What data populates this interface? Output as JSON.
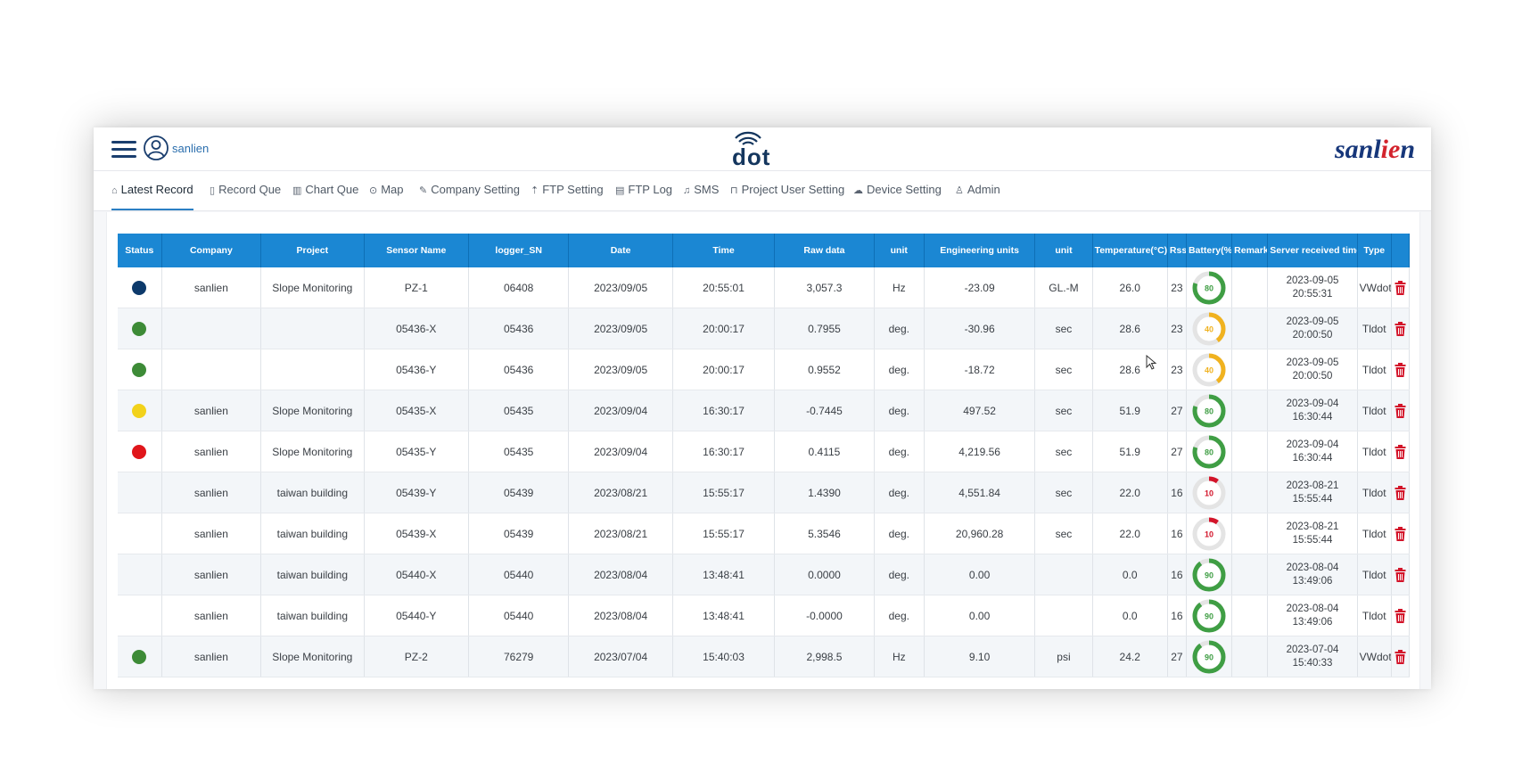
{
  "app": {
    "username": "sanlien",
    "center_logo": "dot",
    "brand_left": "sanl",
    "brand_accent": "ie",
    "brand_right": "n"
  },
  "nav": [
    {
      "label": "Latest Record",
      "icon": "home-icon"
    },
    {
      "label": "Record Que",
      "icon": "document-icon"
    },
    {
      "label": "Chart Que",
      "icon": "bar-chart-icon"
    },
    {
      "label": "Map",
      "icon": "map-pin-icon"
    },
    {
      "label": "Company Setting",
      "icon": "edit-icon"
    },
    {
      "label": "FTP Setting",
      "icon": "upload-icon"
    },
    {
      "label": "FTP Log",
      "icon": "file-icon"
    },
    {
      "label": "SMS",
      "icon": "bell-icon"
    },
    {
      "label": "Project User Setting",
      "icon": "lock-icon"
    },
    {
      "label": "Device Setting",
      "icon": "cloud-icon"
    },
    {
      "label": "Admin",
      "icon": "user-icon"
    }
  ],
  "table": {
    "headers": [
      "Status",
      "Company",
      "Project",
      "Sensor Name",
      "logger_SN",
      "Date",
      "Time",
      "Raw data",
      "unit",
      "Engineering units",
      "unit",
      "Temperature(°C)",
      "Rssi",
      "Battery(%)",
      "Remark",
      "Server received time",
      "Type",
      ""
    ],
    "rows": [
      {
        "status": "#0d3a6b",
        "company": "sanlien",
        "project": "Slope Monitoring",
        "sensor": "PZ-1",
        "logger": "06408",
        "date": "2023/09/05",
        "time": "20:55:01",
        "raw": "3,057.3",
        "unit1": "Hz",
        "eng": "-23.09",
        "unit2": "GL.-M",
        "temp": "26.0",
        "rssi": "23",
        "battery": "80",
        "remark": "",
        "srv_date": "2023-09-05",
        "srv_time": "20:55:31",
        "type": "VWdot"
      },
      {
        "status": "#3d8b37",
        "company": "",
        "project": "",
        "sensor": "05436-X",
        "logger": "05436",
        "date": "2023/09/05",
        "time": "20:00:17",
        "raw": "0.7955",
        "unit1": "deg.",
        "eng": "-30.96",
        "unit2": "sec",
        "temp": "28.6",
        "rssi": "23",
        "battery": "40",
        "remark": "",
        "srv_date": "2023-09-05",
        "srv_time": "20:00:50",
        "type": "Tldot"
      },
      {
        "status": "#3d8b37",
        "company": "",
        "project": "",
        "sensor": "05436-Y",
        "logger": "05436",
        "date": "2023/09/05",
        "time": "20:00:17",
        "raw": "0.9552",
        "unit1": "deg.",
        "eng": "-18.72",
        "unit2": "sec",
        "temp": "28.6",
        "rssi": "23",
        "battery": "40",
        "remark": "",
        "srv_date": "2023-09-05",
        "srv_time": "20:00:50",
        "type": "Tldot"
      },
      {
        "status": "#f2d21b",
        "company": "sanlien",
        "project": "Slope Monitoring",
        "sensor": "05435-X",
        "logger": "05435",
        "date": "2023/09/04",
        "time": "16:30:17",
        "raw": "-0.7445",
        "unit1": "deg.",
        "eng": "497.52",
        "unit2": "sec",
        "temp": "51.9",
        "rssi": "27",
        "battery": "80",
        "remark": "",
        "srv_date": "2023-09-04",
        "srv_time": "16:30:44",
        "type": "Tldot"
      },
      {
        "status": "#e0161b",
        "company": "sanlien",
        "project": "Slope Monitoring",
        "sensor": "05435-Y",
        "logger": "05435",
        "date": "2023/09/04",
        "time": "16:30:17",
        "raw": "0.4115",
        "unit1": "deg.",
        "eng": "4,219.56",
        "unit2": "sec",
        "temp": "51.9",
        "rssi": "27",
        "battery": "80",
        "remark": "",
        "srv_date": "2023-09-04",
        "srv_time": "16:30:44",
        "type": "Tldot"
      },
      {
        "status": "",
        "company": "sanlien",
        "project": "taiwan building",
        "sensor": "05439-Y",
        "logger": "05439",
        "date": "2023/08/21",
        "time": "15:55:17",
        "raw": "1.4390",
        "unit1": "deg.",
        "eng": "4,551.84",
        "unit2": "sec",
        "temp": "22.0",
        "rssi": "16",
        "battery": "10",
        "remark": "",
        "srv_date": "2023-08-21",
        "srv_time": "15:55:44",
        "type": "Tldot"
      },
      {
        "status": "",
        "company": "sanlien",
        "project": "taiwan building",
        "sensor": "05439-X",
        "logger": "05439",
        "date": "2023/08/21",
        "time": "15:55:17",
        "raw": "5.3546",
        "unit1": "deg.",
        "eng": "20,960.28",
        "unit2": "sec",
        "temp": "22.0",
        "rssi": "16",
        "battery": "10",
        "remark": "",
        "srv_date": "2023-08-21",
        "srv_time": "15:55:44",
        "type": "Tldot"
      },
      {
        "status": "",
        "company": "sanlien",
        "project": "taiwan building",
        "sensor": "05440-X",
        "logger": "05440",
        "date": "2023/08/04",
        "time": "13:48:41",
        "raw": "0.0000",
        "unit1": "deg.",
        "eng": "0.00",
        "unit2": "",
        "temp": "0.0",
        "rssi": "16",
        "battery": "90",
        "remark": "",
        "srv_date": "2023-08-04",
        "srv_time": "13:49:06",
        "type": "Tldot"
      },
      {
        "status": "",
        "company": "sanlien",
        "project": "taiwan building",
        "sensor": "05440-Y",
        "logger": "05440",
        "date": "2023/08/04",
        "time": "13:48:41",
        "raw": "-0.0000",
        "unit1": "deg.",
        "eng": "0.00",
        "unit2": "",
        "temp": "0.0",
        "rssi": "16",
        "battery": "90",
        "remark": "",
        "srv_date": "2023-08-04",
        "srv_time": "13:49:06",
        "type": "Tldot"
      },
      {
        "status": "#3d8b37",
        "company": "sanlien",
        "project": "Slope Monitoring",
        "sensor": "PZ-2",
        "logger": "76279",
        "date": "2023/07/04",
        "time": "15:40:03",
        "raw": "2,998.5",
        "unit1": "Hz",
        "eng": "9.10",
        "unit2": "psi",
        "temp": "24.2",
        "rssi": "27",
        "battery": "90",
        "remark": "",
        "srv_date": "2023-07-04",
        "srv_time": "15:40:33",
        "type": "VWdot"
      }
    ]
  },
  "colors": {
    "header_bg": "#1b87d3",
    "battery_high": "#3f9e44",
    "battery_mid": "#f0b21f",
    "battery_low": "#d3142a",
    "trash": "#d3142a"
  }
}
